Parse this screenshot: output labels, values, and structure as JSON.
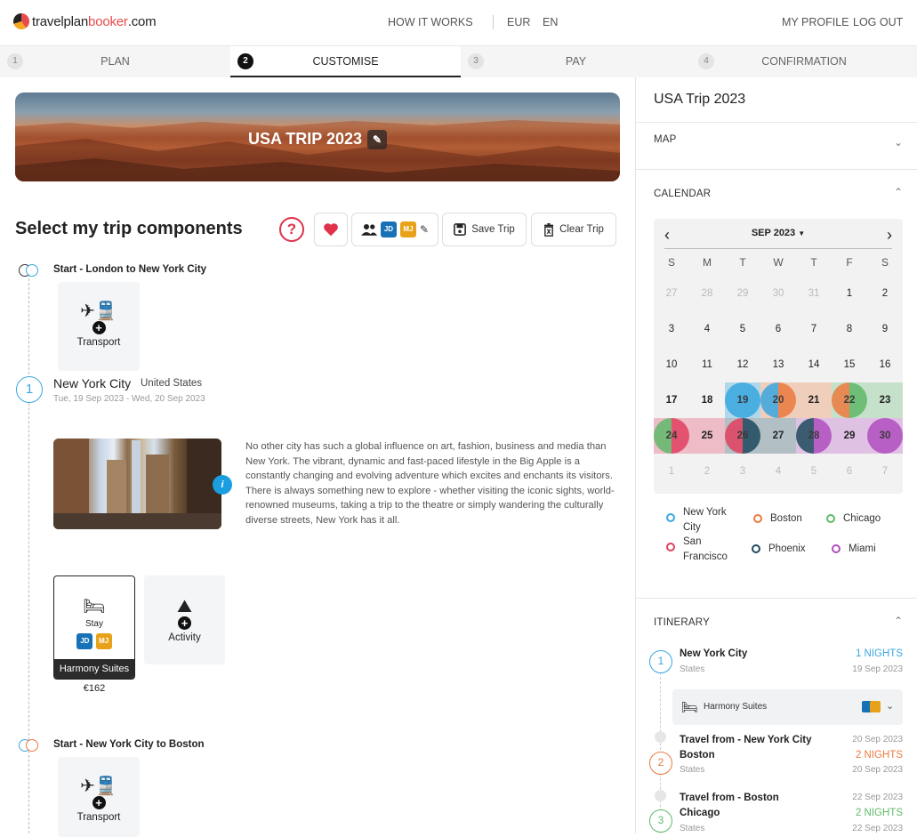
{
  "header": {
    "logo_a": "travelplan",
    "logo_b": "b",
    "logo_c": "ooker",
    "logo_d": ".com",
    "how": "HOW IT WORKS",
    "currency": "EUR",
    "lang": "EN",
    "profile": "MY PROFILE",
    "logout": "LOG OUT"
  },
  "steps": [
    {
      "n": "1",
      "label": "PLAN"
    },
    {
      "n": "2",
      "label": "CUSTOMISE"
    },
    {
      "n": "3",
      "label": "PAY"
    },
    {
      "n": "4",
      "label": "CONFIRMATION"
    }
  ],
  "banner": {
    "title": "USA TRIP 2023",
    "edit_icon": "pencil-icon"
  },
  "section": {
    "title": "Select my trip components",
    "help": "?",
    "save": "Save Trip",
    "clear": "Clear Trip",
    "jd": "JD",
    "mj": "MJ"
  },
  "legs": [
    {
      "title": "Start - London to New York City",
      "card": "Transport"
    },
    {
      "title": "Start - New York City to Boston",
      "card": "Transport"
    }
  ],
  "city": {
    "num": "1",
    "name": "New York City",
    "country": "United States",
    "dates": "Tue, 19 Sep 2023 - Wed, 20 Sep 2023",
    "info": "i",
    "desc": "No other city has such a global influence on art, fashion, business and media than New York. The vibrant, dynamic and fast-paced lifestyle in the Big Apple is a constantly changing and evolving adventure which excites and enchants its visitors. There is always something new to explore - whether visiting the iconic sights, world-renowned museums, taking a trip to the theatre or simply wandering the culturally diverse streets, New York has it all."
  },
  "stay": {
    "label": "Stay",
    "hotel": "Harmony Suites",
    "price": "€162"
  },
  "activity": {
    "label": "Activity"
  },
  "sidebar": {
    "title": "USA Trip 2023",
    "map": "MAP",
    "calendar": "CALENDAR",
    "itinerary": "ITINERARY"
  },
  "calendar": {
    "month": "SEP 2023",
    "prev": "‹",
    "next": "›",
    "dow": [
      "S",
      "M",
      "T",
      "W",
      "T",
      "F",
      "S"
    ],
    "weeks": [
      [
        "27",
        "28",
        "29",
        "30",
        "31",
        "1",
        "2"
      ],
      [
        "3",
        "4",
        "5",
        "6",
        "7",
        "8",
        "9"
      ],
      [
        "10",
        "11",
        "12",
        "13",
        "14",
        "15",
        "16"
      ],
      [
        "17",
        "18",
        "19",
        "20",
        "21",
        "22",
        "23"
      ],
      [
        "24",
        "25",
        "26",
        "27",
        "28",
        "29",
        "30"
      ],
      [
        "1",
        "2",
        "3",
        "4",
        "5",
        "6",
        "7"
      ]
    ]
  },
  "cities_legend": [
    {
      "name": "New York City",
      "color": "#3aa7e0"
    },
    {
      "name": "Boston",
      "color": "#ec7a3e"
    },
    {
      "name": "Chicago",
      "color": "#5fb96a"
    },
    {
      "name": "San Francisco",
      "color": "#e2405f"
    },
    {
      "name": "Phoenix",
      "color": "#1f4a5e"
    },
    {
      "name": "Miami",
      "color": "#b24fc0"
    }
  ],
  "itinerary": {
    "i1": {
      "num": "1",
      "title": "New York City",
      "sub": "States",
      "nights": "1 NIGHTS",
      "date": "19 Sep 2023"
    },
    "hotel": "Harmony Suites",
    "t1": {
      "title": "Travel from - New York City",
      "date": "20 Sep 2023"
    },
    "i2": {
      "num": "2",
      "title": "Boston",
      "sub": "States",
      "nights": "2 NIGHTS",
      "date": "20 Sep 2023"
    },
    "t2": {
      "title": "Travel from - Boston",
      "date": "22 Sep 2023"
    },
    "i3": {
      "num": "3",
      "title": "Chicago",
      "sub": "States",
      "nights": "2 NIGHTS",
      "date": "22 Sep 2023"
    }
  }
}
